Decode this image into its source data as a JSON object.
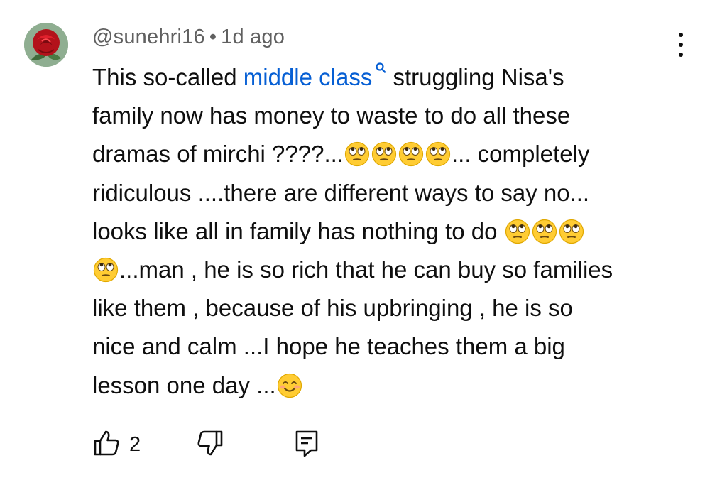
{
  "comment": {
    "username": "@sunehri16",
    "separator": "•",
    "time_ago": "1d ago",
    "link_text": "middle class",
    "lines": {
      "l1_before": "This so-called ",
      "l1_after": "struggling Nisa's",
      "l2": "family now has money to waste to do all these",
      "l3_a": "dramas of mirchi ????...",
      "l3_b": "... completely",
      "l4": "ridiculous ....there are different ways to say no...",
      "l5": "looks like all in family has nothing to do ",
      "l6": "...man , he is so rich that he can buy so families",
      "l7": "like them , because of his upbringing , he is so",
      "l8": "nice and calm ...I hope he teaches them a big",
      "l9": "lesson one day ..."
    },
    "emojis": [
      "face-with-rolling-eyes",
      "smiling-face-with-smiling-eyes"
    ]
  },
  "actions": {
    "like_count": "2",
    "icons": [
      "thumbs-up-icon",
      "thumbs-down-icon",
      "reply-icon"
    ]
  },
  "colors": {
    "link": "#065fd4",
    "meta": "#606060",
    "text": "#0f0f0f",
    "emoji": "#ffcc33"
  }
}
